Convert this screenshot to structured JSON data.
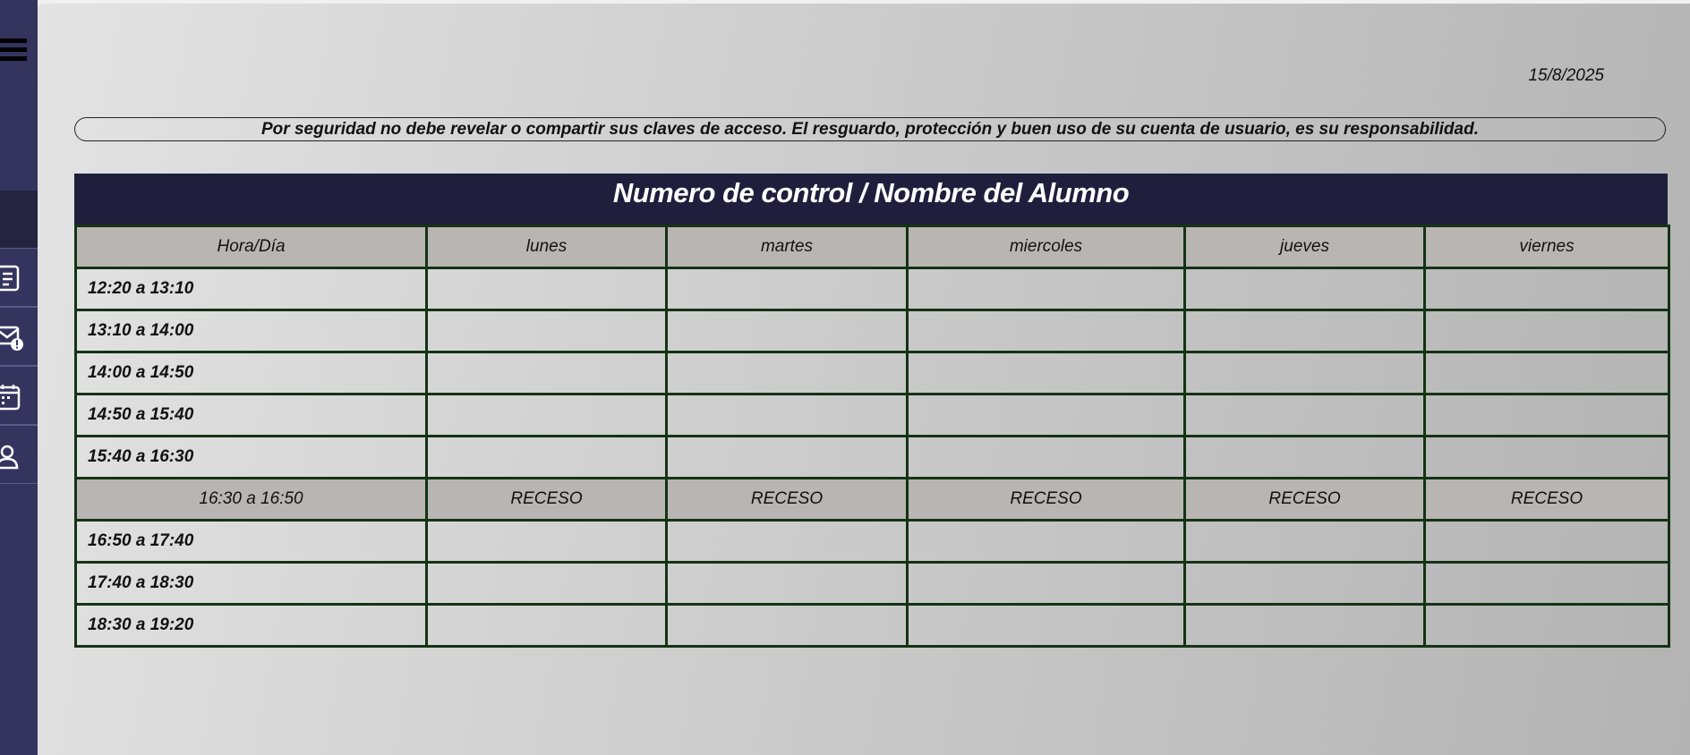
{
  "date": "15/8/2025",
  "notice": "Por seguridad no debe revelar o compartir sus claves de acceso. El resguardo, protección y buen uso de su cuenta de usuario, es su responsabilidad.",
  "schedule": {
    "title": "Numero de control / Nombre del Alumno",
    "columns": [
      "Hora/Día",
      "lunes",
      "martes",
      "miercoles",
      "jueves",
      "viernes"
    ],
    "rows": [
      {
        "time": "12:20 a 13:10",
        "cells": [
          "",
          "",
          "",
          "",
          ""
        ]
      },
      {
        "time": "13:10 a 14:00",
        "cells": [
          "",
          "",
          "",
          "",
          ""
        ]
      },
      {
        "time": "14:00 a 14:50",
        "cells": [
          "",
          "",
          "",
          "",
          ""
        ]
      },
      {
        "time": "14:50 a 15:40",
        "cells": [
          "",
          "",
          "",
          "",
          ""
        ]
      },
      {
        "time": "15:40 a 16:30",
        "cells": [
          "",
          "",
          "",
          "",
          ""
        ]
      },
      {
        "time": "16:30 a 16:50",
        "cells": [
          "RECESO",
          "RECESO",
          "RECESO",
          "RECESO",
          "RECESO"
        ],
        "recess": true
      },
      {
        "time": "16:50 a 17:40",
        "cells": [
          "",
          "",
          "",
          "",
          ""
        ]
      },
      {
        "time": "17:40 a 18:30",
        "cells": [
          "",
          "",
          "",
          "",
          ""
        ]
      },
      {
        "time": "18:30 a 19:20",
        "cells": [
          "",
          "",
          "",
          "",
          ""
        ]
      }
    ]
  },
  "sidebar": {
    "items": [
      {
        "icon": "list-icon"
      },
      {
        "icon": "mail-alert-icon"
      },
      {
        "icon": "calendar-icon"
      },
      {
        "icon": "user-icon"
      }
    ]
  },
  "colors": {
    "sidebar": "#34345f",
    "header": "#1f1f3d",
    "grid_border": "#143314",
    "header_cell": "#b9b5b3"
  }
}
